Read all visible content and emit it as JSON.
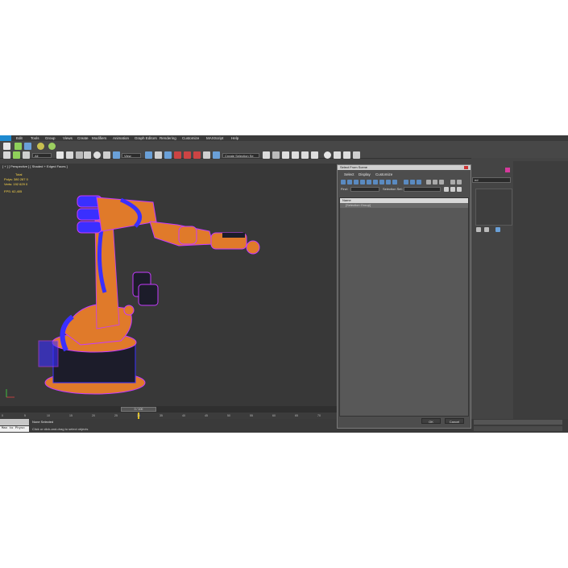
{
  "menu": [
    "Edit",
    "Tools",
    "Group",
    "Views",
    "Create",
    "Modifiers",
    "Animation",
    "Graph Editors",
    "Rendering",
    "Customize",
    "MAXScript",
    "Help"
  ],
  "toolbar": {
    "filter_select": "All",
    "view_select": "View",
    "selection_set_placeholder": "Create Selection Se"
  },
  "viewport": {
    "label": "[ + ] [ Perspective ] [ Shaded + Edged Faces ]",
    "stats": {
      "total_label": "Total",
      "polys_label": "Polys:",
      "polys_value": "380 287",
      "polys_sel": "0",
      "verts_label": "Verts:",
      "verts_value": "192 629",
      "verts_sel": "0",
      "fps_label": "FPS:",
      "fps_value": "62,405"
    }
  },
  "timeline": {
    "frame": "0 / 100",
    "ticks": [
      "0",
      "5",
      "10",
      "15",
      "20",
      "25",
      "30",
      "35",
      "40",
      "45",
      "50",
      "55",
      "60",
      "65",
      "70"
    ]
  },
  "status": {
    "maxscript": "Max to Physc",
    "selected": "None Selected",
    "hint": "Click or click-and-drag to select objects"
  },
  "dialog": {
    "title": "Select From Scene",
    "menu": [
      "Select",
      "Display",
      "Customize"
    ],
    "find_label": "Find:",
    "selection_set_label": "Selection Set:",
    "column_name": "Name",
    "item": "[Selection Group]",
    "ok_label": "OK",
    "cancel_label": "Cancel"
  },
  "right_panel": {
    "dropdown": "ed"
  },
  "colors": {
    "robot_orange": "#e07a2a",
    "wire_blue": "#3a2fff",
    "wire_magenta": "#c63aff",
    "stats_yellow": "#ffd94a",
    "accent_pink": "#d63a9c"
  }
}
